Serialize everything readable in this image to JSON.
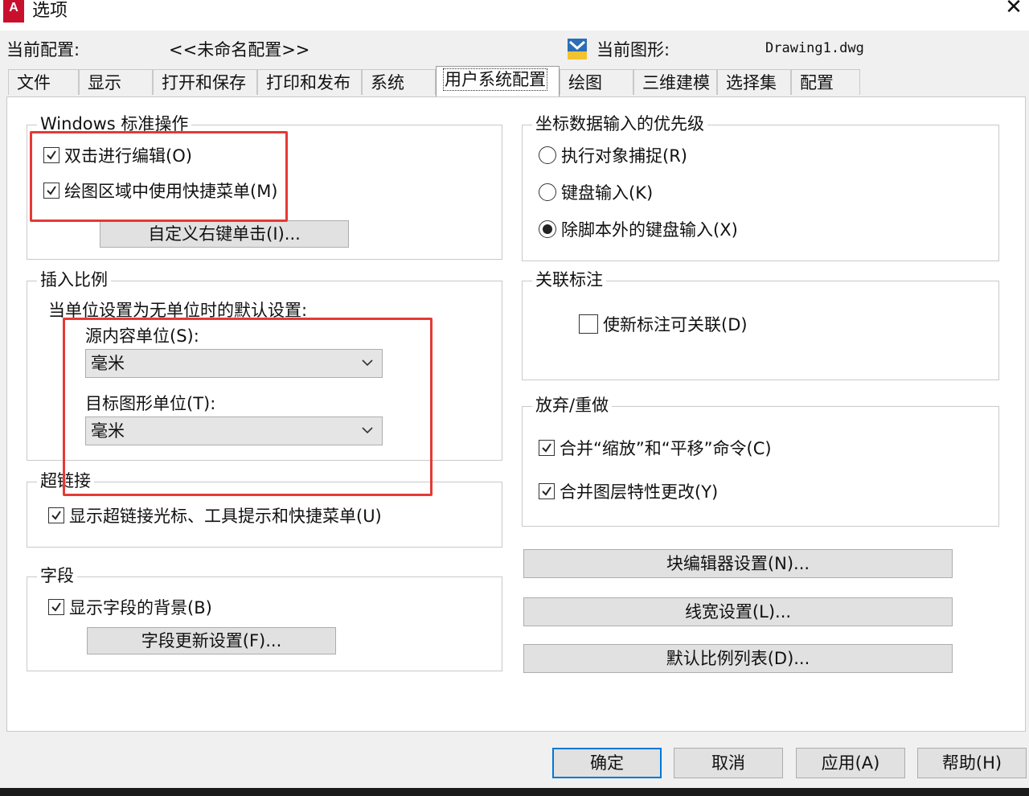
{
  "window": {
    "title": "选项",
    "app_icon_text": "A",
    "close_glyph": "✕"
  },
  "profile": {
    "current_profile_label": "当前配置:",
    "current_profile_value": "<<未命名配置>>",
    "current_drawing_label": "当前图形:",
    "current_drawing_value": "Drawing1.dwg"
  },
  "tabs": [
    {
      "label": "文件"
    },
    {
      "label": "显示"
    },
    {
      "label": "打开和保存"
    },
    {
      "label": "打印和发布"
    },
    {
      "label": "系统"
    },
    {
      "label": "用户系统配置",
      "active": true
    },
    {
      "label": "绘图"
    },
    {
      "label": "三维建模"
    },
    {
      "label": "选择集"
    },
    {
      "label": "配置"
    }
  ],
  "windows_ops": {
    "title": "Windows 标准操作",
    "double_click_edit": "双击进行编辑(O)",
    "shortcut_menu": "绘图区域中使用快捷菜单(M)",
    "right_click_button": "自定义右键单击(I)..."
  },
  "insert_scale": {
    "title": "插入比例",
    "description": "当单位设置为无单位时的默认设置:",
    "source_label": "源内容单位(S):",
    "source_value": "毫米",
    "target_label": "目标图形单位(T):",
    "target_value": "毫米"
  },
  "hyperlink": {
    "title": "超链接",
    "option": "显示超链接光标、工具提示和快捷菜单(U)"
  },
  "fields": {
    "title": "字段",
    "option": "显示字段的背景(B)",
    "update_button": "字段更新设置(F)..."
  },
  "coord_priority": {
    "title": "坐标数据输入的优先级",
    "options": [
      "执行对象捕捉(R)",
      "键盘输入(K)",
      "除脚本外的键盘输入(X)"
    ],
    "selected_index": 2
  },
  "assoc_dim": {
    "title": "关联标注",
    "option": "使新标注可关联(D)"
  },
  "undo_redo": {
    "title": "放弃/重做",
    "option_zoom_pan": "合并“缩放”和“平移”命令(C)",
    "option_layer": "合并图层特性更改(Y)"
  },
  "side_buttons": {
    "block_editor": "块编辑器设置(N)...",
    "lineweight": "线宽设置(L)...",
    "scale_list": "默认比例列表(D)..."
  },
  "footer_buttons": {
    "ok": "确定",
    "cancel": "取消",
    "apply": "应用(A)",
    "help": "帮助(H)"
  },
  "colors": {
    "highlight": "#e53935",
    "ok_border": "#0078d7"
  }
}
